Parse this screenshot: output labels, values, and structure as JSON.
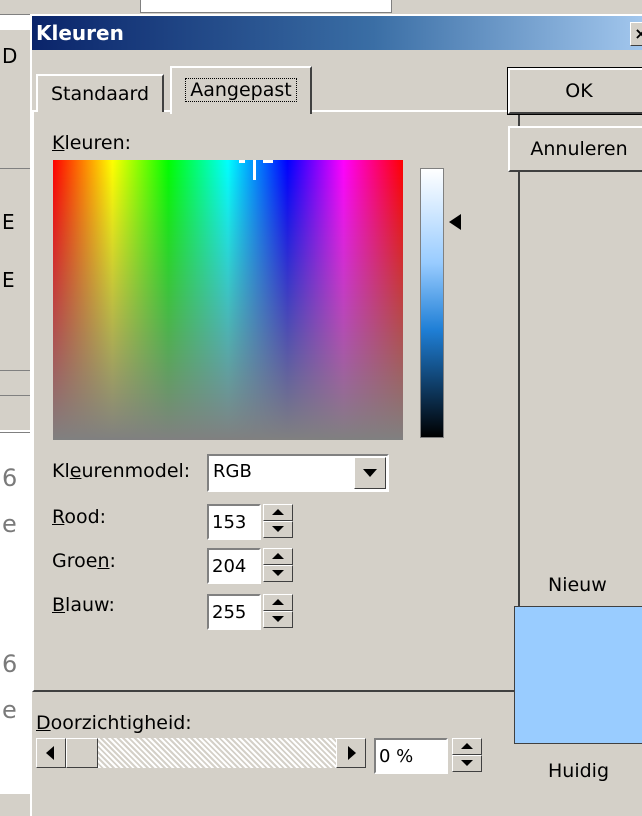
{
  "dialog": {
    "title": "Kleuren",
    "close_glyph": "×"
  },
  "tabs": [
    {
      "label": "Standaard"
    },
    {
      "label": "Aangepast"
    }
  ],
  "custom": {
    "colors_label": "Kleuren:",
    "colors_label_mnemonic": "K",
    "colors_label_rest": "leuren:",
    "model_label_pre": "Kl",
    "model_label_mnemonic": "e",
    "model_label_post": "urenmodel:",
    "model_value": "RGB",
    "red_mnemonic": "R",
    "red_rest": "ood:",
    "red_value": "153",
    "green_pre": "Groe",
    "green_mnemonic": "n",
    "green_post": ":",
    "green_value": "204",
    "blue_mnemonic": "B",
    "blue_rest": "lauw:",
    "blue_value": "255"
  },
  "buttons": {
    "ok": "OK",
    "cancel": "Annuleren"
  },
  "preview": {
    "new_label": "Nieuw",
    "current_label": "Huidig",
    "new_color": "#99ccff"
  },
  "transparency": {
    "label_mnemonic": "D",
    "label_rest": "oorzichtigheid:",
    "value": "0 %"
  },
  "background_app": {
    "letters": [
      "D",
      "E",
      "E"
    ],
    "gray_chars": [
      "6",
      "e",
      "6",
      "e"
    ]
  }
}
